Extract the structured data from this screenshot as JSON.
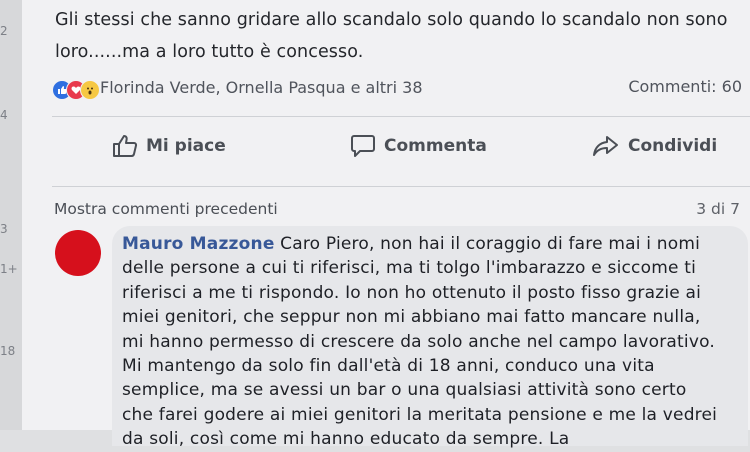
{
  "gutter_numbers": [
    "2",
    "4",
    "3",
    "1+",
    "18"
  ],
  "post": {
    "text": "Gli stessi che sanno gridare allo scandalo solo quando lo scandalo non sono loro......ma a loro tutto è concesso."
  },
  "reactions": {
    "icons": [
      "like-icon",
      "love-icon",
      "wow-icon"
    ],
    "people": "Florinda Verde, Ornella Pasqua e altri 38",
    "comments_count": "Commenti: 60"
  },
  "actions": {
    "like": "Mi piace",
    "comment": "Commenta",
    "share": "Condividi"
  },
  "comments": {
    "show_previous": "Mostra commenti precedenti",
    "pager": "3 di 7",
    "items": [
      {
        "author": "Mauro Mazzone",
        "text": "Caro Piero, non hai il coraggio di fare mai i nomi delle persone a cui ti riferisci, ma ti tolgo l'imbarazzo e siccome ti riferisci a me ti rispondo. Io non ho ottenuto il posto fisso grazie ai miei genitori, che seppur non mi abbiano mai fatto mancare nulla, mi hanno permesso di crescere da solo anche nel campo lavorativo. Mi mantengo da solo fin dall'età di 18 anni, conduco una vita semplice, ma se avessi un bar o una qualsiasi attività sono certo che farei godere ai miei genitori la meritata pensione e me la vedrei da soli, così come mi hanno educato da sempre. La"
      }
    ]
  },
  "colors": {
    "like_blue": "#2f6fe0",
    "love_red": "#e83a4d",
    "wow_yellow": "#f6c843",
    "author_blue": "#385898",
    "avatar_red": "#d6101c"
  }
}
